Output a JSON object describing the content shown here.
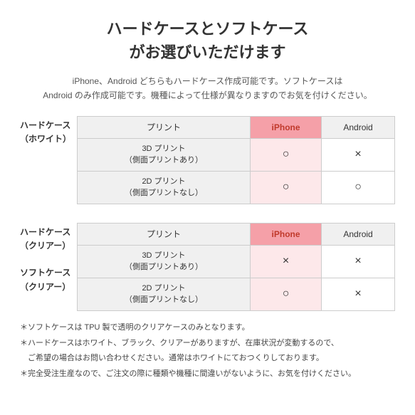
{
  "title": {
    "line1": "ハードケースとソフトケース",
    "line2": "がお選びいただけます"
  },
  "subtitle": "iPhone、Android どちらもハードケース作成可能です。ソフトケースは\nAndroid のみ作成可能です。機種によって仕様が異なりますのでお気を付けください。",
  "table1": {
    "section_label_line1": "ハードケース",
    "section_label_line2": "（ホワイト）",
    "header": {
      "col1": "プリント",
      "col2": "iPhone",
      "col3": "Android"
    },
    "rows": [
      {
        "label_line1": "3D プリント",
        "label_line2": "（側面プリントあり）",
        "iphone": "○",
        "android": "×"
      },
      {
        "label_line1": "2D プリント",
        "label_line2": "（側面プリントなし）",
        "iphone": "○",
        "android": "○"
      }
    ]
  },
  "table2": {
    "section_label_line1": "ハードケース",
    "section_label_line2": "（クリアー）",
    "section_label2_line1": "ソフトケース",
    "section_label2_line2": "（クリアー）",
    "header": {
      "col1": "プリント",
      "col2": "iPhone",
      "col3": "Android"
    },
    "rows": [
      {
        "label_line1": "3D プリント",
        "label_line2": "（側面プリントあり）",
        "iphone": "×",
        "android": "×"
      },
      {
        "label_line1": "2D プリント",
        "label_line2": "（側面プリントなし）",
        "iphone": "○",
        "android": "×"
      }
    ]
  },
  "notes": [
    "＊ソフトケースは TPU 製で透明のクリアケースのみとなります。",
    "＊ハードケースはホワイト、ブラック、クリアーがありますが、在庫状況が変動するので、",
    "　ご希望の場合はお問い合わせください。通常はホワイトにておつくりしております。",
    "＊完全受注生産なので、ご注文の際に種類や機種に間違いがないように、お気を付けください。"
  ]
}
